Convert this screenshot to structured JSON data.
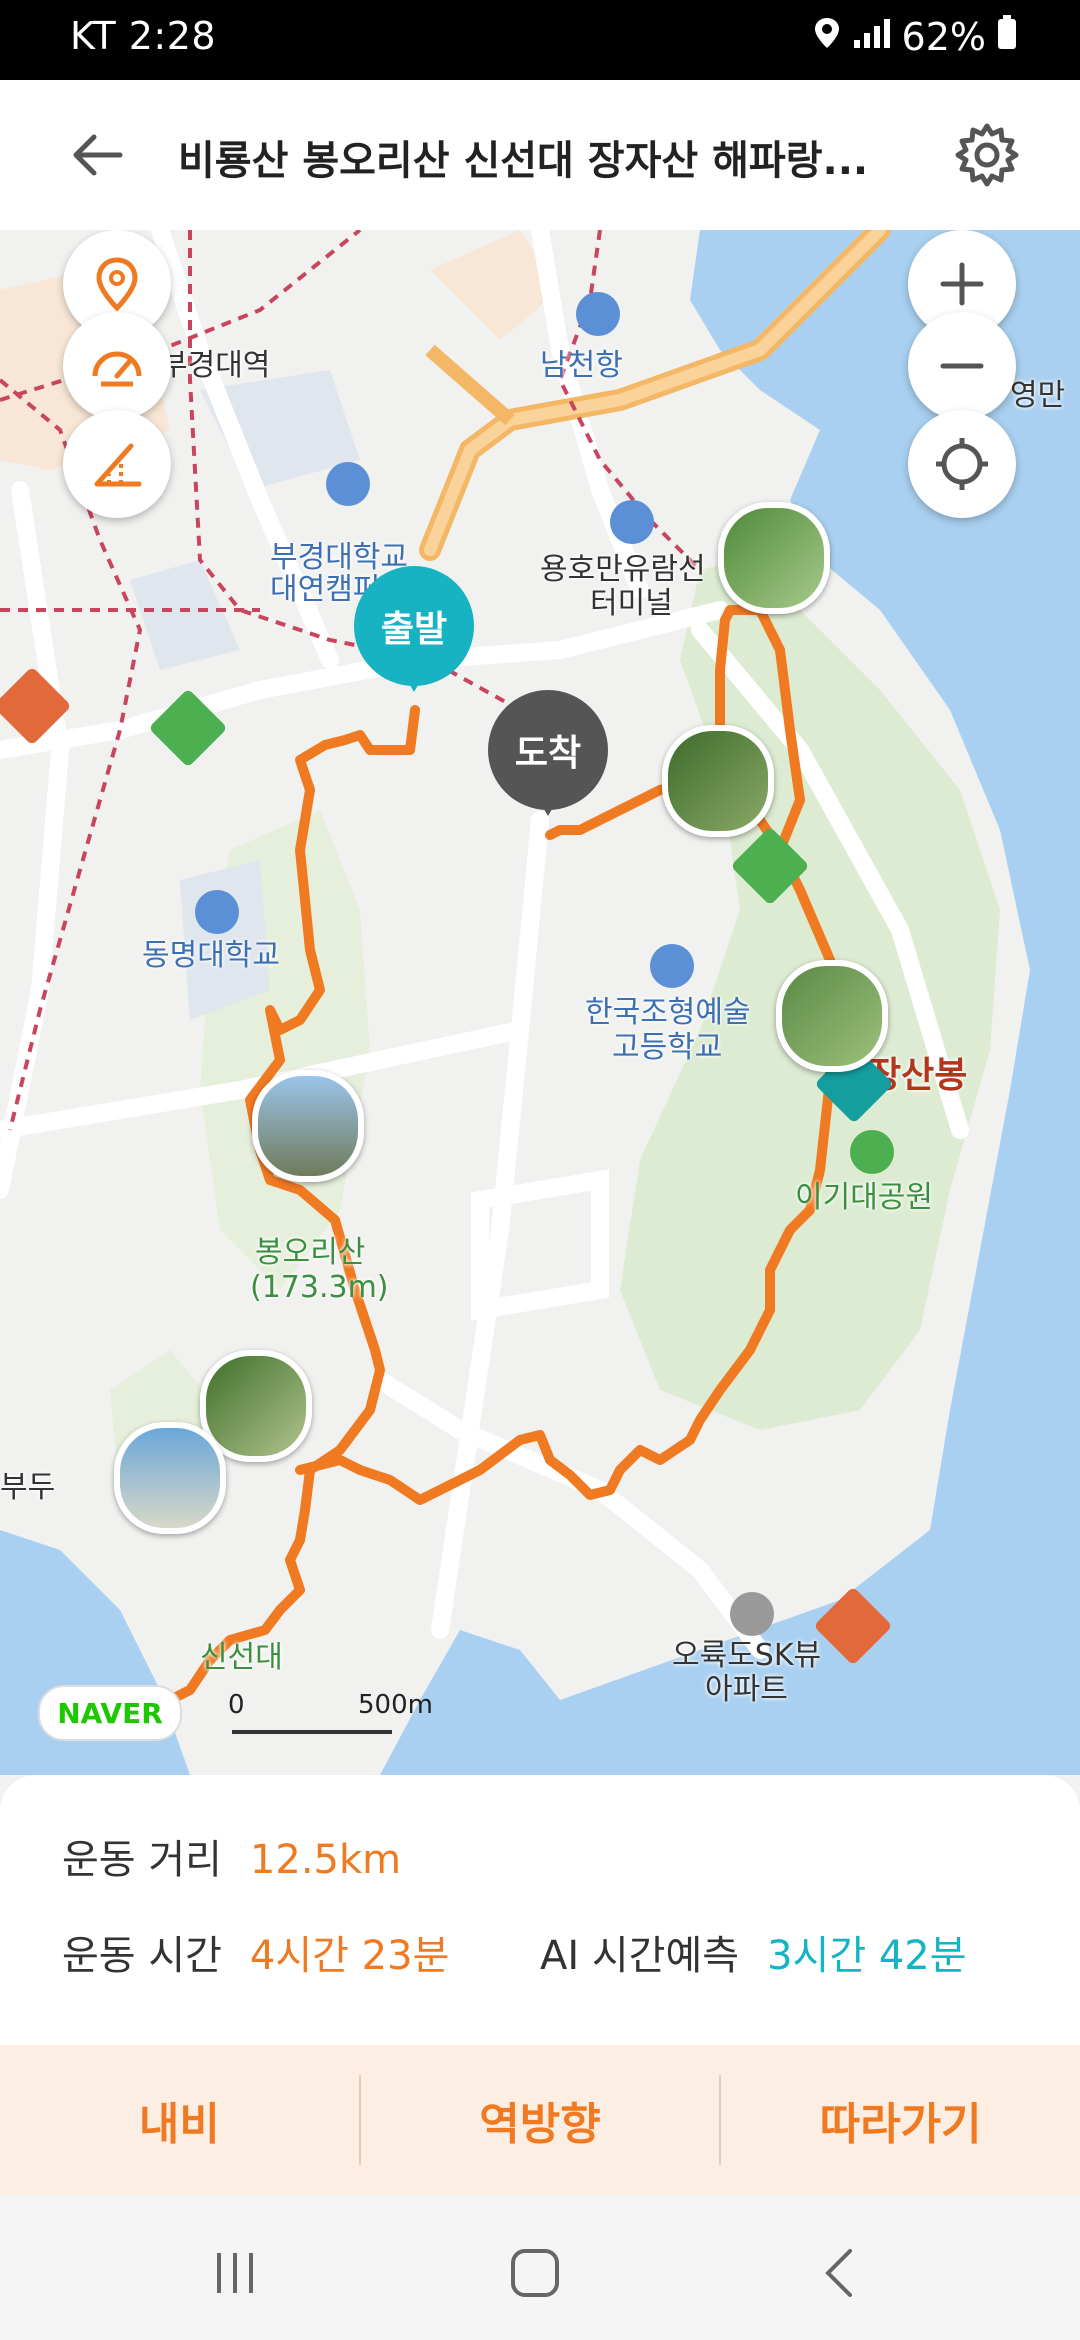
{
  "status_bar": {
    "carrier_time": "KT 2:28",
    "battery": "62%"
  },
  "header": {
    "title": "비룡산 봉오리산 신선대 장자산 해파랑..."
  },
  "map": {
    "pins": {
      "start": "출발",
      "end": "도착"
    },
    "labels": {
      "station": "부경대역",
      "port": "남천항",
      "univ1_l1": "부경대학교",
      "univ1_l2": "대연캠퍼스",
      "terminal_l1": "용호만유람선",
      "terminal_l2": "터미널",
      "univ2": "동명대학교",
      "school_l1": "한국조형예술",
      "school_l2": "고등학교",
      "peak": "장산봉",
      "park": "이기대공원",
      "mountain_l1": "봉오리산",
      "mountain_l2": "(173.3m)",
      "pier": "부두",
      "apt_l1": "오륙도SK뷰",
      "apt_l2": "아파트",
      "cliff": "신선대",
      "yeongman": "영만"
    },
    "logo": "NAVER",
    "scale": {
      "zero": "0",
      "dist": "500m"
    }
  },
  "stats": {
    "distance_label": "운동 거리",
    "distance_value": "12.5km",
    "time_label": "운동 시간",
    "time_value": "4시간 23분",
    "ai_label": "AI 시간예측",
    "ai_value": "3시간 42분"
  },
  "actions": {
    "navigate": "내비",
    "reverse": "역방향",
    "follow": "따라가기"
  },
  "colors": {
    "route": "#f07a22",
    "start_pin": "#17b3c2",
    "end_pin": "#555555",
    "sea": "#a9d0f0",
    "park": "#dcebd1"
  }
}
